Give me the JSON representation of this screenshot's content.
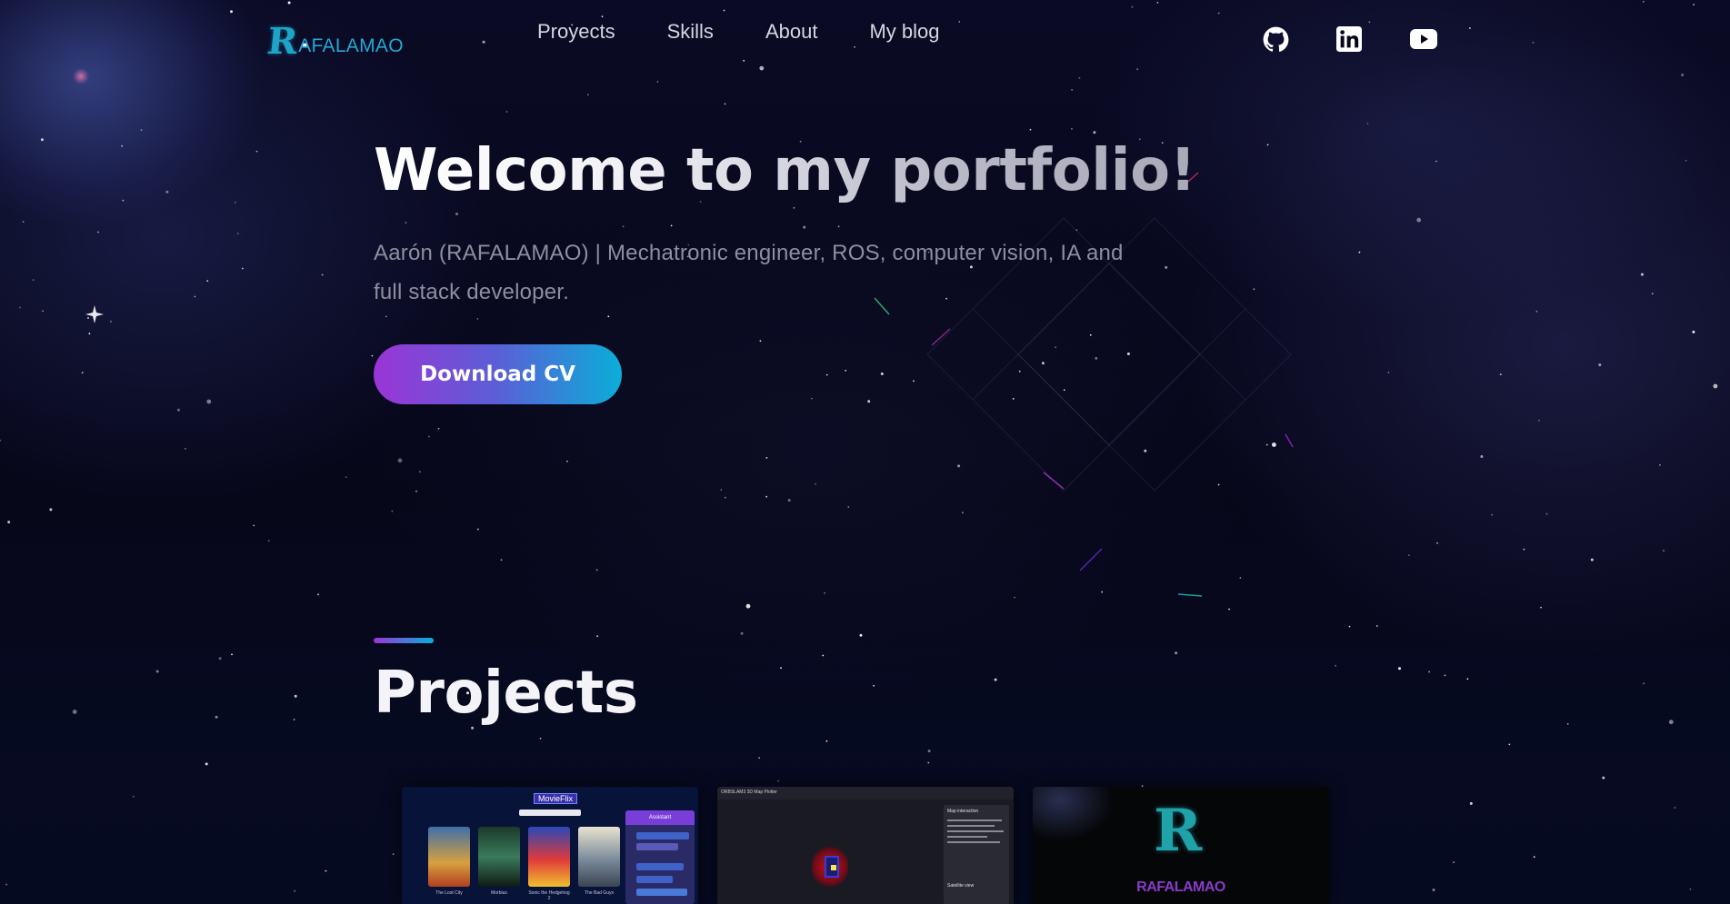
{
  "nav": {
    "logo_initial": "R",
    "logo_text": "AFALAMAO",
    "links": [
      "Proyects",
      "Skills",
      "About",
      "My blog"
    ],
    "social": [
      "github-icon",
      "linkedin-icon",
      "youtube-icon"
    ]
  },
  "hero": {
    "title": "Welcome to my portfolio!",
    "subtitle": "Aarón (RAFALAMAO) | Mechatronic engineer, ROS, computer vision, IA and full stack developer.",
    "cv_button": "Download CV"
  },
  "projects": {
    "title": "Projects",
    "cards": [
      {
        "name": "movieflix",
        "header": "MovieFlix",
        "chat_title": "Assistant",
        "posters": [
          "The Lost City",
          "Morbius",
          "Sonic the Hedgehog 2",
          "The Bad Guys"
        ]
      },
      {
        "name": "map-plotter",
        "header": "ORBSLAM3 3D Map Plotter",
        "side_title": "Map interaction",
        "side_sub": "Satellite view"
      },
      {
        "name": "rafalamao-logo",
        "logo_initial": "R",
        "logo_text": "RAFALAMAO"
      }
    ]
  },
  "colors": {
    "accent_purple": "#9b35d6",
    "accent_cyan": "#0aaed8",
    "logo_cyan": "#24a8d4"
  }
}
